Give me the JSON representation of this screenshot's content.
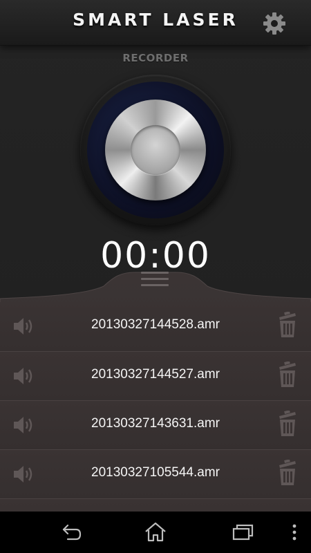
{
  "header": {
    "title": "SMART LASER",
    "settings_icon": "gear-icon"
  },
  "recorder": {
    "label": "RECORDER",
    "timer": "00:00",
    "record_button_icon": "record-knob"
  },
  "recordings": [
    {
      "name": "20130327144528.amr",
      "play_icon": "speaker-icon",
      "delete_icon": "trash-icon"
    },
    {
      "name": "20130327144527.amr",
      "play_icon": "speaker-icon",
      "delete_icon": "trash-icon"
    },
    {
      "name": "20130327143631.amr",
      "play_icon": "speaker-icon",
      "delete_icon": "trash-icon"
    },
    {
      "name": "20130327105544.amr",
      "play_icon": "speaker-icon",
      "delete_icon": "trash-icon"
    }
  ],
  "navbar": {
    "back_icon": "back-icon",
    "home_icon": "home-icon",
    "recents_icon": "recent-apps-icon",
    "menu_icon": "overflow-menu-icon"
  },
  "colors": {
    "background": "#242424",
    "list_background": "#3a3333",
    "text": "#ffffff",
    "label_gray": "#6e6e6e"
  }
}
